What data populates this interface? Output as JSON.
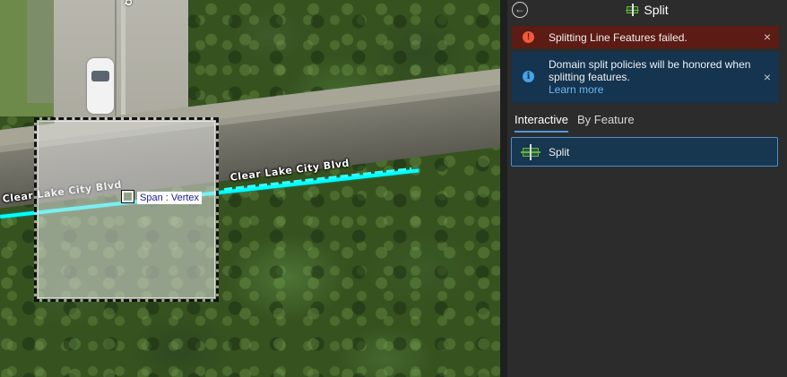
{
  "map": {
    "road_label_left": "Clear Lake City Blvd",
    "road_label_right": "Clear Lake City Blvd",
    "side_street_label": "Q",
    "snap_label": "Span : Vertex"
  },
  "panel": {
    "title": "Split",
    "messages": {
      "error": "Splitting Line Features failed.",
      "info": "Domain split policies will be honored when splitting features.",
      "info_link": "Learn more"
    },
    "tabs": [
      "Interactive",
      "By Feature"
    ],
    "tool": {
      "label": "Split"
    }
  },
  "icons": {
    "back": "back-arrow-icon",
    "split": "split-icon",
    "error": "error-icon",
    "info": "info-icon",
    "close": "close-icon"
  },
  "colors": {
    "error_bg": "#5c1b14",
    "info_bg": "#15344f",
    "accent": "#4c9ae0",
    "snap_line": "#00ffff"
  }
}
